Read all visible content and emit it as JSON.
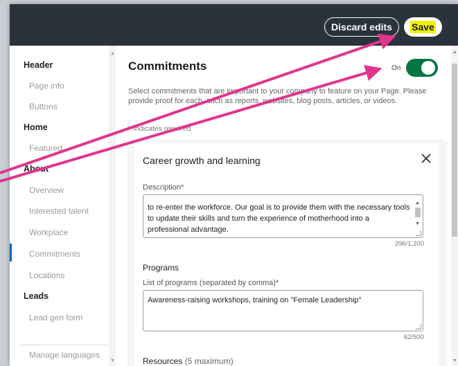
{
  "topbar": {
    "discard_label": "Discard edits",
    "save_label": "Save"
  },
  "sidebar": {
    "header": "Header",
    "header_items": [
      "Page info",
      "Buttons"
    ],
    "home": "Home",
    "home_items": [
      "Featured"
    ],
    "about": "About",
    "about_items": [
      "Overview",
      "Interested talent",
      "Workplace",
      "Commitments",
      "Locations"
    ],
    "leads": "Leads",
    "leads_items": [
      "Lead gen form"
    ],
    "manage_languages": "Manage languages"
  },
  "main": {
    "title": "Commitments",
    "toggle_label": "On",
    "intro": "Select commitments that are important to your company to feature on your Page. Please provide proof for each, such as reports, websites, blog posts, articles, or videos.",
    "required_note": "* Indicates required",
    "card": {
      "title": "Career growth and learning",
      "description_label": "Description*",
      "description_text": "to re-enter the workforce. Our goal is to provide them with the necessary tools to update their skills and turn the experience of motherhood into a professional advantage.",
      "description_count": "296/1,200",
      "programs_heading": "Programs",
      "programs_label": "List of programs (separated by comma)*",
      "programs_value": "Awareness-raising workshops, training on \"Female Leadership\"",
      "programs_count": "62/500",
      "resources_heading": "Resources",
      "resources_note": "(5 maximum)"
    }
  },
  "colors": {
    "topbar": "#2a323b",
    "toggle_on": "#057642",
    "annotation_arrow": "#e0358f",
    "save_highlight": "#f2f200"
  }
}
